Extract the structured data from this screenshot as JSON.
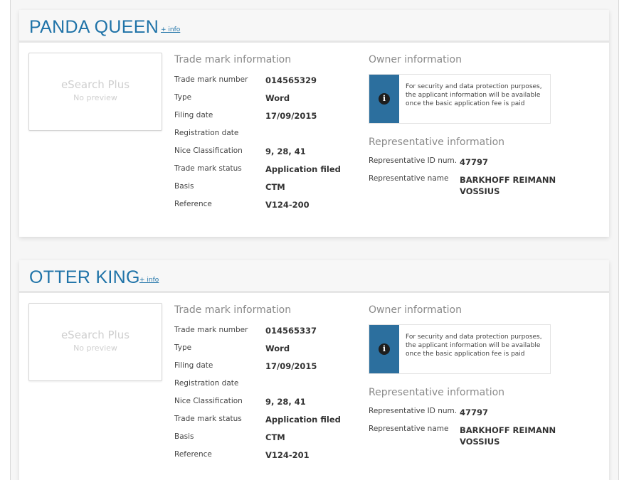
{
  "labels": {
    "info_link": "+ info",
    "preview_brand": "eSearch Plus",
    "preview_none": "No preview",
    "tm_section": "Trade mark information",
    "owner_section": "Owner information",
    "rep_section": "Representative information",
    "tm_number": "Trade mark number",
    "type": "Type",
    "filing_date": "Filing date",
    "registration_date": "Registration date",
    "nice_classification": "Nice Classification",
    "tm_status": "Trade mark status",
    "basis": "Basis",
    "reference": "Reference",
    "rep_id": "Representative ID num...",
    "rep_name": "Representative name",
    "owner_notice": "For security and data protection purposes, the applicant information will be available once the basic application fee is paid"
  },
  "colors": {
    "title": "#1f73a8",
    "notice_bar": "#2c6f9e"
  },
  "records": [
    {
      "name": "PANDA QUEEN",
      "tm_number": "014565329",
      "type": "Word",
      "filing_date": "17/09/2015",
      "registration_date": "",
      "nice_classification": "9, 28, 41",
      "tm_status": "Application filed",
      "basis": "CTM",
      "reference": "V124-200",
      "rep_id": "47797",
      "rep_name": "BARKHOFF REIMANN VOSSIUS"
    },
    {
      "name": "OTTER KING",
      "tm_number": "014565337",
      "type": "Word",
      "filing_date": "17/09/2015",
      "registration_date": "",
      "nice_classification": "9, 28, 41",
      "tm_status": "Application filed",
      "basis": "CTM",
      "reference": "V124-201",
      "rep_id": "47797",
      "rep_name": "BARKHOFF REIMANN VOSSIUS"
    }
  ]
}
